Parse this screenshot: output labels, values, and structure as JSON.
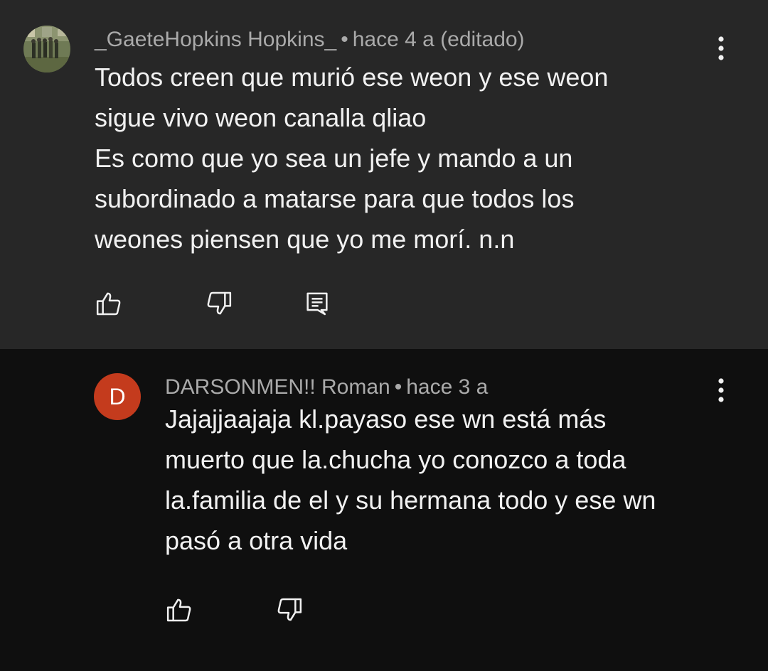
{
  "comments": [
    {
      "author": "_GaeteHopkins Hopkins_",
      "separator": "•",
      "time": "hace 4 a (editado)",
      "avatar_icon": "group-photo-avatar",
      "lines": [
        "Todos creen que murió ese weon y ese weon",
        "sigue vivo weon canalla qliao",
        "Es como que yo sea un jefe y mando a un",
        "subordinado a matarse para que todos los",
        "weones piensen que yo me morí. n.n"
      ],
      "actions": [
        "thumbs-up-icon",
        "thumbs-down-icon",
        "reply-comment-icon"
      ],
      "background": "#272727"
    },
    {
      "author": "DARSONMEN!! Roman",
      "separator": "•",
      "time": "hace 3 a",
      "avatar_letter": "D",
      "avatar_color": "#c43b1d",
      "lines": [
        "Jajajjaajaja kl.payaso ese wn está más",
        "muerto que la.chucha yo conozco a toda",
        "la.familia de el y su hermana todo y ese wn",
        "pasó a otra vida"
      ],
      "actions": [
        "thumbs-up-icon",
        "thumbs-down-icon"
      ],
      "background": "#0f0f0f"
    }
  ],
  "icons": {
    "more": "vertical-ellipsis-icon"
  },
  "colors": {
    "text_primary": "#f1f1f1",
    "text_secondary": "#aaaaaa",
    "icon": "#f1f1f1"
  }
}
